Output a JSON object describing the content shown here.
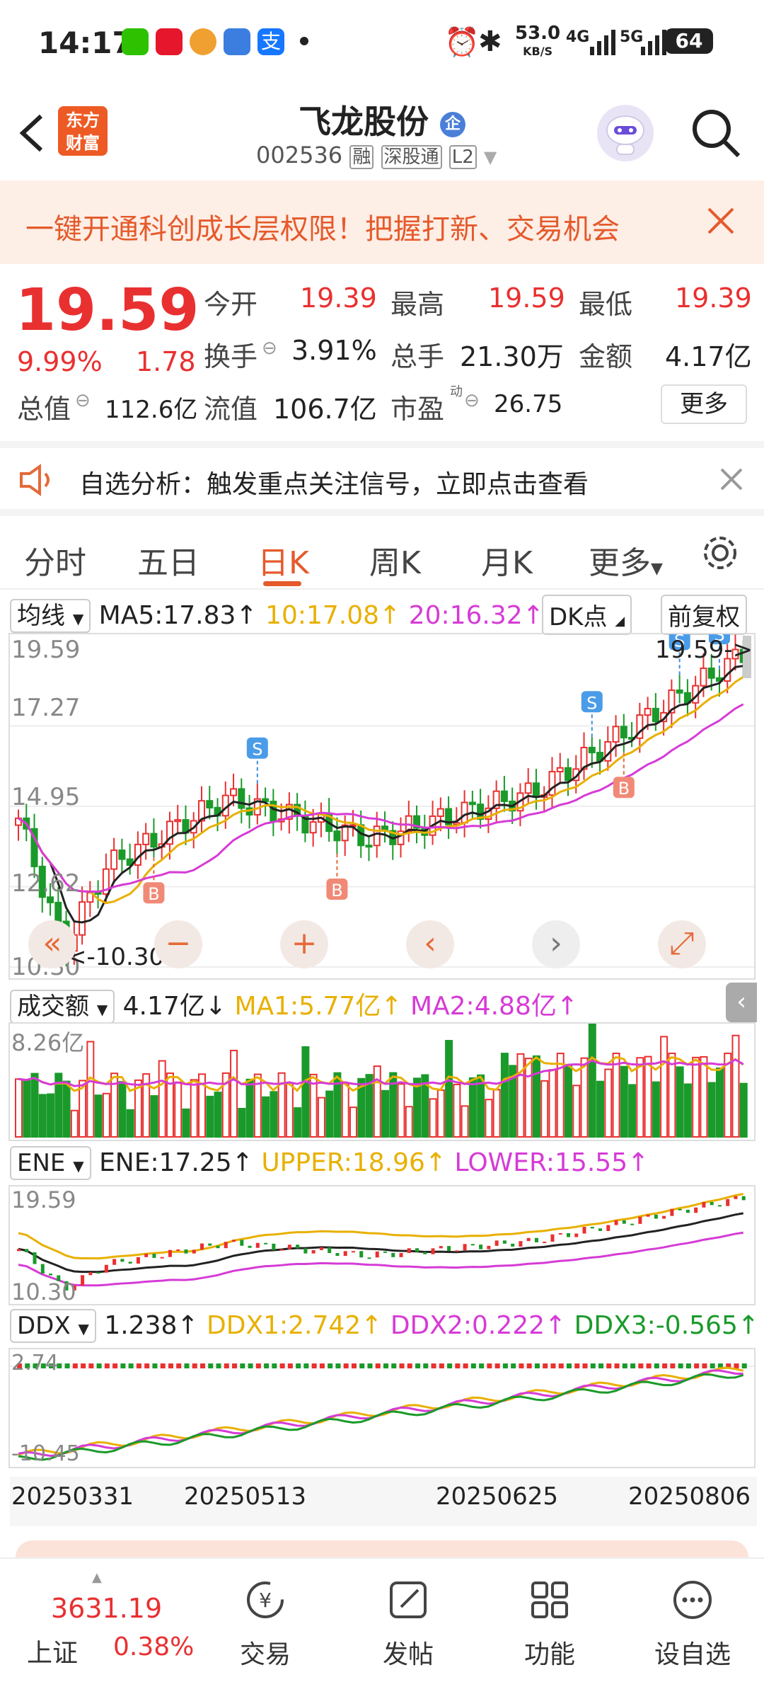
{
  "status_bar": {
    "time": "14:17",
    "net_speed": "53.0",
    "net_unit": "KB/S",
    "net_4g": "4G",
    "net_5g": "5G",
    "battery": "64"
  },
  "header": {
    "logo_line1": "东方",
    "logo_line2": "财富",
    "stock_name": "飞龙股份",
    "enterprise_badge": "企",
    "stock_code": "002536",
    "tag_margin": "融",
    "tag_connect": "深股通",
    "tag_level": "L2"
  },
  "banner": {
    "text": "一键开通科创成长层权限！把握打新、交易机会"
  },
  "quote": {
    "price": "19.59",
    "change_pct": "9.99%",
    "change_amt": "1.78",
    "open_label": "今开",
    "open": "19.39",
    "high_label": "最高",
    "high": "19.59",
    "low_label": "最低",
    "low": "19.39",
    "turnover_label": "换手",
    "turnover": "3.91%",
    "volume_label": "总手",
    "volume": "21.30万",
    "amount_label": "金额",
    "amount": "4.17亿",
    "mktcap_label": "总值",
    "mktcap": "112.6亿",
    "float_label": "流值",
    "float": "106.7亿",
    "pe_label": "市盈",
    "pe_sup": "动",
    "pe": "26.75",
    "more_button": "更多"
  },
  "notice": {
    "text": "自选分析：触发重点关注信号，立即点击查看"
  },
  "tabs": {
    "items": [
      "分时",
      "五日",
      "日K",
      "周K",
      "月K",
      "更多"
    ],
    "active": "日K"
  },
  "kline": {
    "indicator_select": "均线",
    "ma5": "MA5:17.83",
    "ma10": "10:17.08",
    "ma20": "20:16.32",
    "dk_button": "DK点",
    "adjust_button": "前复权",
    "axis_top": "19.59",
    "axis_2": "17.27",
    "axis_3": "14.95",
    "axis_4": "12.62",
    "axis_bottom": "10.30",
    "max_marker": "19.59->",
    "min_marker": "<-10.30"
  },
  "volume": {
    "indicator_select": "成交额",
    "value": "4.17亿",
    "ma1": "MA1:5.77亿",
    "ma2": "MA2:4.88亿",
    "axis_top": "8.26亿"
  },
  "ene": {
    "indicator_select": "ENE",
    "ene": "ENE:17.25",
    "upper": "UPPER:18.96",
    "lower": "LOWER:15.55",
    "axis_top": "19.59",
    "axis_bottom": "10.30"
  },
  "ddx": {
    "indicator_select": "DDX",
    "ddx": "1.238",
    "ddx1": "DDX1:2.742",
    "ddx2": "DDX2:0.222",
    "ddx3": "DDX3:-0.565",
    "axis_top": "2.74",
    "axis_bottom": "-10.45"
  },
  "dates": [
    "20250331",
    "20250513",
    "20250625",
    "20250806"
  ],
  "bottom_nav": {
    "index_value": "3631.19",
    "index_name": "上证",
    "index_change": "0.38%",
    "items": [
      "交易",
      "发帖",
      "功能",
      "设自选"
    ]
  },
  "colors": {
    "up": "#e93030",
    "down": "#1a9a2a",
    "ma5": "#222222",
    "ma10": "#e8b000",
    "ma20": "#d63bd6",
    "brand": "#ee5a24"
  }
}
